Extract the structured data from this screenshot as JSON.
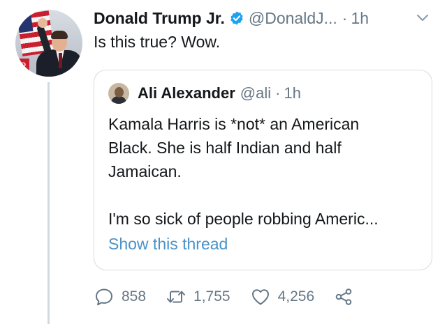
{
  "tweet": {
    "author_name": "Donald Trump Jr.",
    "handle": "@DonaldJ...",
    "separator": "·",
    "time": "1h",
    "text": "Is this true? Wow."
  },
  "avatar": {
    "banner_text": "YO"
  },
  "quoted_tweet": {
    "author_name": "Ali Alexander",
    "handle": "@ali",
    "separator": "·",
    "time": "1h",
    "lines": [
      "Kamala Harris is *not* an American",
      "Black. She is half Indian and half",
      "Jamaican.",
      "I'm so sick of people robbing Americ..."
    ],
    "show_thread": "Show this thread"
  },
  "actions": {
    "replies": "858",
    "retweets": "1,755",
    "likes": "4,256"
  },
  "colors": {
    "text": "#14171a",
    "muted": "#657786",
    "link": "#4a92c8",
    "verified": "#1da1f2",
    "border": "#d5dde2"
  },
  "icons": {
    "verified": "verified-badge-icon",
    "chevron": "chevron-down-icon",
    "reply": "reply-icon",
    "retweet": "retweet-icon",
    "like": "heart-icon",
    "share": "share-icon"
  }
}
